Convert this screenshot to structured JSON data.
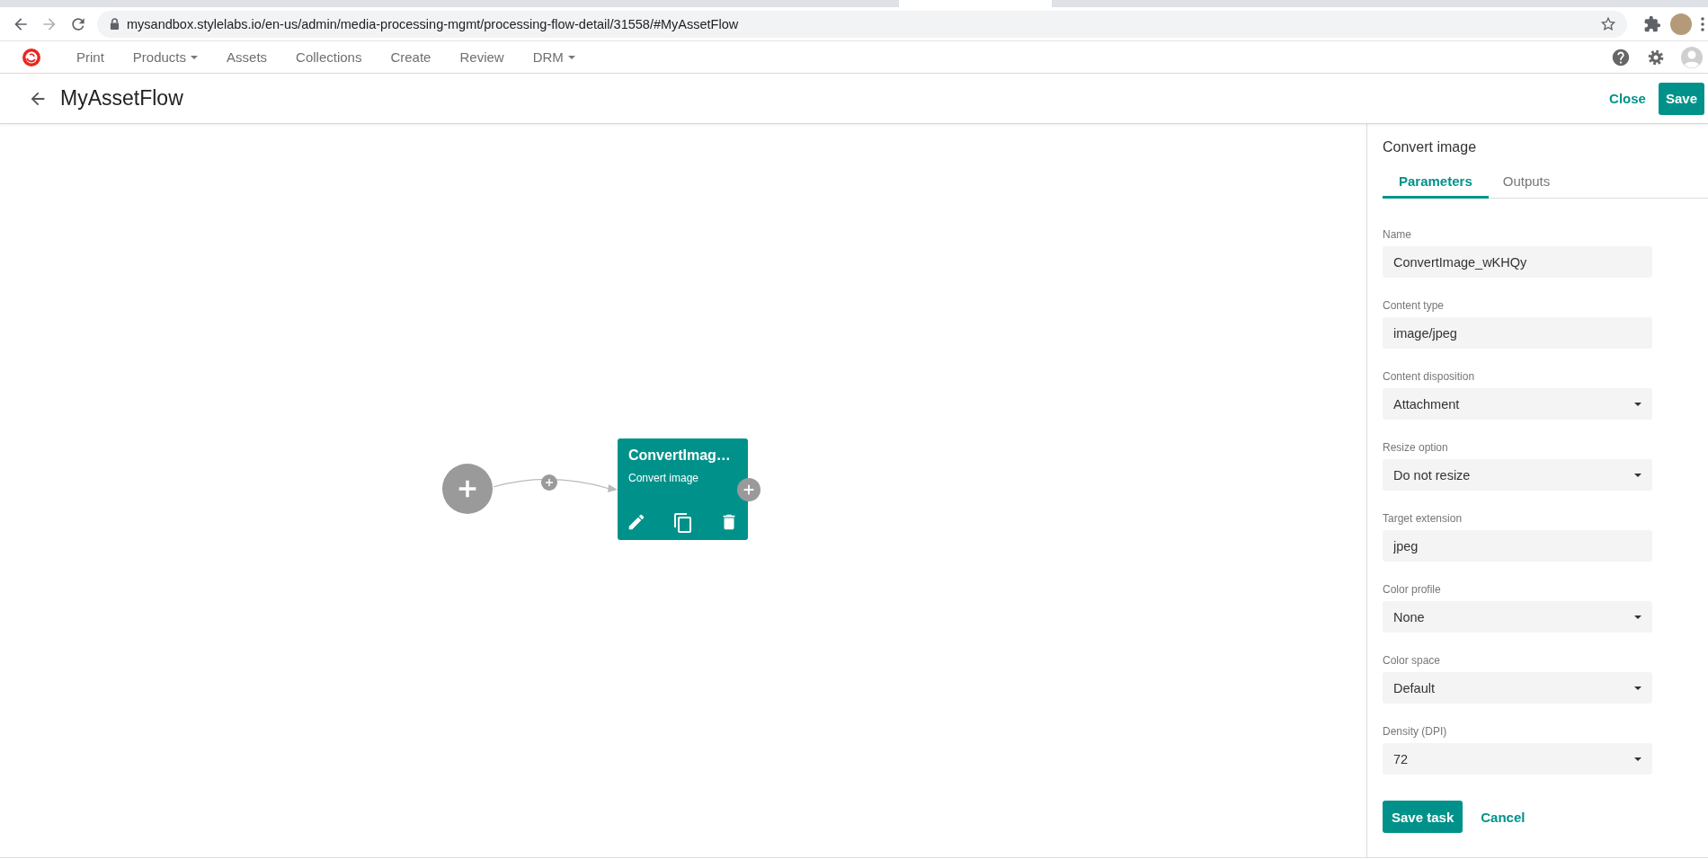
{
  "browser": {
    "url": "mysandbox.stylelabs.io/en-us/admin/media-processing-mgmt/processing-flow-detail/31558/#MyAssetFlow"
  },
  "nav": {
    "items": [
      {
        "label": "Print",
        "has_menu": false
      },
      {
        "label": "Products",
        "has_menu": true
      },
      {
        "label": "Assets",
        "has_menu": false
      },
      {
        "label": "Collections",
        "has_menu": false
      },
      {
        "label": "Create",
        "has_menu": false
      },
      {
        "label": "Review",
        "has_menu": false
      },
      {
        "label": "DRM",
        "has_menu": true
      }
    ]
  },
  "header": {
    "title": "MyAssetFlow",
    "close": "Close",
    "save": "Save"
  },
  "canvas": {
    "nodes": [
      {
        "title": "ConvertImag…",
        "subtitle": "Convert image"
      }
    ]
  },
  "panel": {
    "title": "Convert image",
    "tabs": [
      {
        "label": "Parameters",
        "selected": true
      },
      {
        "label": "Outputs",
        "selected": false
      }
    ],
    "fields": [
      {
        "label": "Name",
        "kind": "text",
        "value": "ConvertImage_wKHQy"
      },
      {
        "label": "Content type",
        "kind": "text",
        "value": "image/jpeg"
      },
      {
        "label": "Content disposition",
        "kind": "select",
        "value": "Attachment"
      },
      {
        "label": "Resize option",
        "kind": "select",
        "value": "Do not resize"
      },
      {
        "label": "Target extension",
        "kind": "text",
        "value": "jpeg"
      },
      {
        "label": "Color profile",
        "kind": "select",
        "value": "None"
      },
      {
        "label": "Color space",
        "kind": "select",
        "value": "Default"
      },
      {
        "label": "Density (DPI)",
        "kind": "select",
        "value": "72"
      }
    ],
    "save": "Save task",
    "cancel": "Cancel"
  }
}
